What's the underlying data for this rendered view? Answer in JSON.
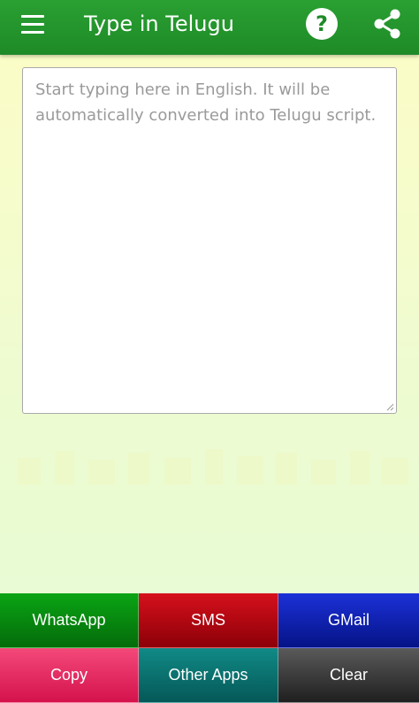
{
  "app_bar": {
    "title": "Type in Telugu",
    "menu_icon": "hamburger-menu-icon",
    "help_icon": "help-question-icon",
    "help_glyph": "?",
    "share_icon": "share-icon",
    "background_color": "#1e8a27"
  },
  "editor": {
    "value": "",
    "placeholder": "Start typing here in English. It will be automatically converted into Telugu script."
  },
  "buttons": {
    "whatsapp": {
      "label": "WhatsApp",
      "color": "#077a0e"
    },
    "sms": {
      "label": "SMS",
      "color": "#b20a13"
    },
    "gmail": {
      "label": "GMail",
      "color": "#0d1fb0"
    },
    "copy": {
      "label": "Copy",
      "color": "#e62a62"
    },
    "other_apps": {
      "label": "Other Apps",
      "color": "#0a6f6d"
    },
    "clear": {
      "label": "Clear",
      "color": "#3a3a3a"
    }
  }
}
